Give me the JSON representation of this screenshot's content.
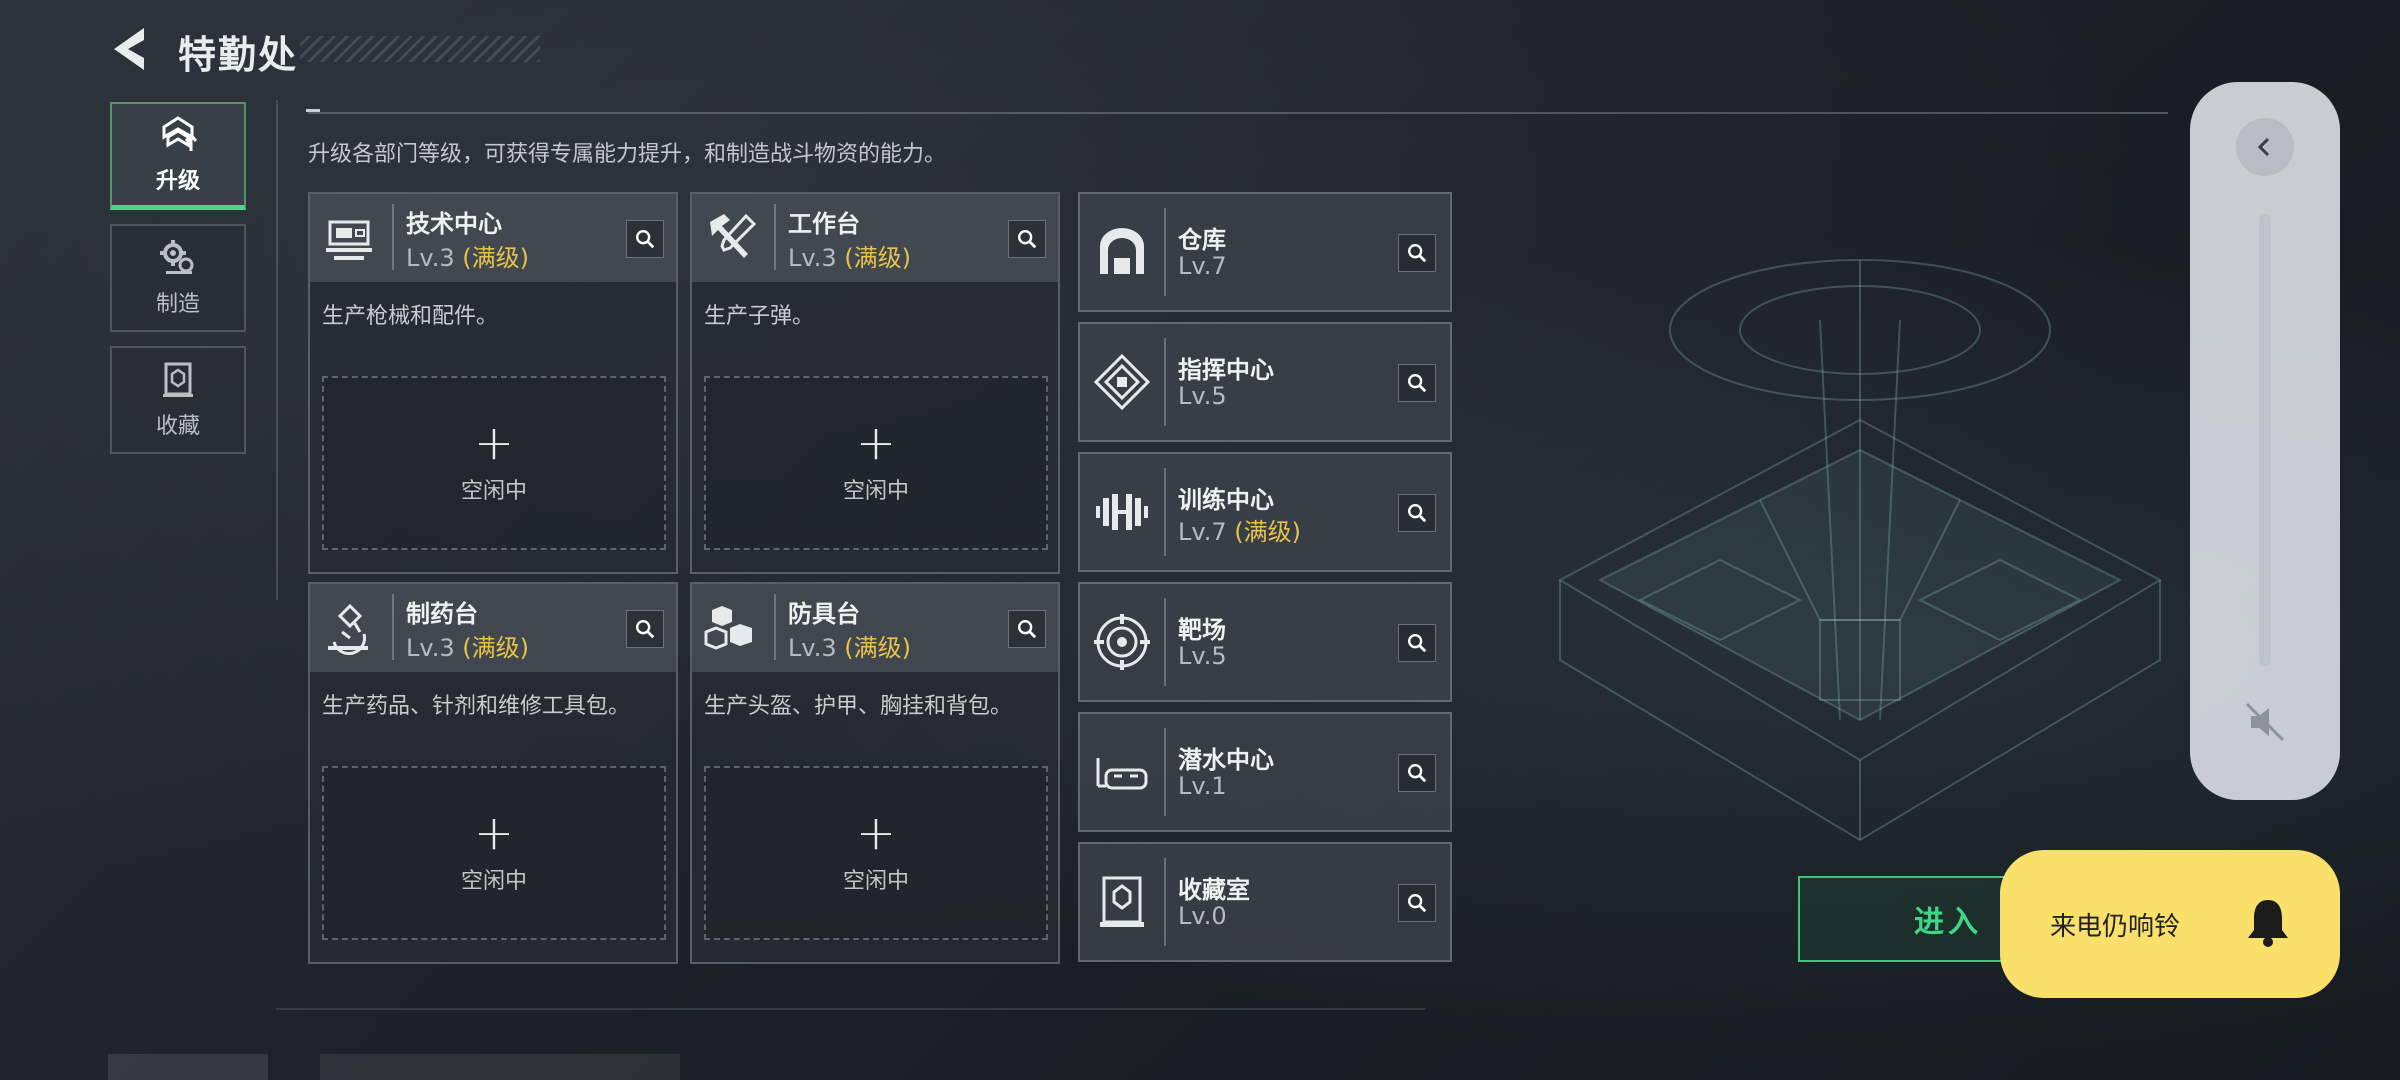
{
  "header": {
    "title": "特勤处"
  },
  "nav": {
    "items": [
      {
        "label": "升级",
        "icon": "upgrade-icon",
        "active": true
      },
      {
        "label": "制造",
        "icon": "gears-icon",
        "active": false
      },
      {
        "label": "收藏",
        "icon": "collection-icon",
        "active": false
      }
    ]
  },
  "intro": "升级各部门等级，可获得专属能力提升，和制造战斗物资的能力。",
  "facilities": [
    {
      "name": "技术中心",
      "level": "Lv.3",
      "max_tag": "(满级)",
      "desc": "生产枪械和配件。",
      "slot_status": "空闲中",
      "icon": "tech-center-icon"
    },
    {
      "name": "工作台",
      "level": "Lv.3",
      "max_tag": "(满级)",
      "desc": "生产子弹。",
      "slot_status": "空闲中",
      "icon": "workbench-icon"
    },
    {
      "name": "制药台",
      "level": "Lv.3",
      "max_tag": "(满级)",
      "desc": "生产药品、针剂和维修工具包。",
      "slot_status": "空闲中",
      "icon": "pharmacy-icon"
    },
    {
      "name": "防具台",
      "level": "Lv.3",
      "max_tag": "(满级)",
      "desc": "生产头盔、护甲、胸挂和背包。",
      "slot_status": "空闲中",
      "icon": "armor-bench-icon"
    }
  ],
  "departments": [
    {
      "name": "仓库",
      "level": "Lv.7",
      "max_tag": "",
      "icon": "warehouse-icon"
    },
    {
      "name": "指挥中心",
      "level": "Lv.5",
      "max_tag": "",
      "icon": "command-center-icon"
    },
    {
      "name": "训练中心",
      "level": "Lv.7",
      "max_tag": "(满级)",
      "icon": "training-center-icon"
    },
    {
      "name": "靶场",
      "level": "Lv.5",
      "max_tag": "",
      "icon": "shooting-range-icon"
    },
    {
      "name": "潜水中心",
      "level": "Lv.1",
      "max_tag": "",
      "icon": "diving-center-icon"
    },
    {
      "name": "收藏室",
      "level": "Lv.0",
      "max_tag": "",
      "icon": "collection-room-icon"
    }
  ],
  "enter_button": {
    "label": "进入"
  },
  "volume_overlay": {
    "level": 0,
    "muted": true
  },
  "ring_toast": {
    "text": "来电仍响铃"
  },
  "colors": {
    "accent_green": "#4fd28a",
    "max_level_gold": "#e8c24a",
    "toast_yellow": "#f8e06b"
  }
}
